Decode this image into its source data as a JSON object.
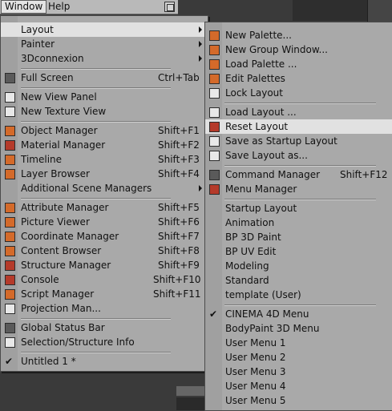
{
  "menubar": {
    "window_label": "Window",
    "help_label": "Help",
    "icon": "window-layout-icon"
  },
  "main_menu": {
    "items": [
      {
        "label": "Layout",
        "shortcut": "",
        "submenu": true,
        "icon": ""
      },
      {
        "label": "Painter",
        "shortcut": "",
        "submenu": true,
        "icon": ""
      },
      {
        "label": "3Dconnexion",
        "shortcut": "",
        "submenu": true,
        "icon": ""
      },
      {
        "label": "Full Screen",
        "shortcut": "Ctrl+Tab",
        "icon": "fullscreen-icon"
      },
      {
        "label": "New View Panel",
        "shortcut": "",
        "icon": "view-panel-icon"
      },
      {
        "label": "New Texture View",
        "shortcut": "",
        "icon": "texture-view-icon"
      },
      {
        "label": "Object Manager",
        "shortcut": "Shift+F1",
        "icon": "object-manager-icon"
      },
      {
        "label": "Material Manager",
        "shortcut": "Shift+F2",
        "icon": "material-manager-icon"
      },
      {
        "label": "Timeline",
        "shortcut": "Shift+F3",
        "icon": "timeline-icon"
      },
      {
        "label": "Layer Browser",
        "shortcut": "Shift+F4",
        "icon": "layer-browser-icon"
      },
      {
        "label": "Additional Scene Managers",
        "shortcut": "",
        "submenu": true,
        "icon": ""
      },
      {
        "label": "Attribute Manager",
        "shortcut": "Shift+F5",
        "icon": "attribute-manager-icon"
      },
      {
        "label": "Picture Viewer",
        "shortcut": "Shift+F6",
        "icon": "picture-viewer-icon"
      },
      {
        "label": "Coordinate Manager",
        "shortcut": "Shift+F7",
        "icon": "coordinate-manager-icon"
      },
      {
        "label": "Content Browser",
        "shortcut": "Shift+F8",
        "icon": "content-browser-icon"
      },
      {
        "label": "Structure Manager",
        "shortcut": "Shift+F9",
        "icon": "structure-manager-icon"
      },
      {
        "label": "Console",
        "shortcut": "Shift+F10",
        "icon": "console-icon"
      },
      {
        "label": "Script Manager",
        "shortcut": "Shift+F11",
        "icon": "script-manager-icon"
      },
      {
        "label": "Projection Man...",
        "shortcut": "",
        "icon": "projection-man-icon"
      },
      {
        "label": "Global Status Bar",
        "shortcut": "",
        "icon": "status-bar-icon"
      },
      {
        "label": "Selection/Structure Info",
        "shortcut": "",
        "icon": "selection-info-icon"
      },
      {
        "label": "Untitled 1 *",
        "shortcut": "",
        "checked": true,
        "icon": "checkmark-icon"
      }
    ]
  },
  "layout_submenu": {
    "items": [
      {
        "label": "New Palette...",
        "shortcut": "",
        "icon": "new-palette-icon"
      },
      {
        "label": "New Group Window...",
        "shortcut": "",
        "icon": "new-group-window-icon"
      },
      {
        "label": "Load Palette ...",
        "shortcut": "",
        "icon": "load-palette-icon"
      },
      {
        "label": "Edit Palettes",
        "shortcut": "",
        "icon": "edit-palettes-icon"
      },
      {
        "label": "Lock Layout",
        "shortcut": "",
        "icon": "lock-layout-icon"
      },
      {
        "label": "Load Layout ...",
        "shortcut": "",
        "icon": "load-layout-icon"
      },
      {
        "label": "Reset Layout",
        "shortcut": "",
        "icon": "reset-layout-icon"
      },
      {
        "label": "Save as Startup Layout",
        "shortcut": "",
        "icon": "save-startup-layout-icon"
      },
      {
        "label": "Save Layout as...",
        "shortcut": "",
        "icon": "save-layout-icon"
      },
      {
        "label": "Command Manager",
        "shortcut": "Shift+F12",
        "icon": "command-manager-icon"
      },
      {
        "label": "Menu Manager",
        "shortcut": "",
        "icon": "menu-manager-icon"
      },
      {
        "label": "Startup Layout",
        "shortcut": ""
      },
      {
        "label": "Animation",
        "shortcut": ""
      },
      {
        "label": "BP 3D Paint",
        "shortcut": ""
      },
      {
        "label": "BP UV Edit",
        "shortcut": ""
      },
      {
        "label": "Modeling",
        "shortcut": ""
      },
      {
        "label": "Standard",
        "shortcut": ""
      },
      {
        "label": "template (User)",
        "shortcut": ""
      },
      {
        "label": "CINEMA 4D Menu",
        "shortcut": "",
        "checked": true
      },
      {
        "label": "BodyPaint 3D Menu",
        "shortcut": ""
      },
      {
        "label": "User Menu 1",
        "shortcut": ""
      },
      {
        "label": "User Menu 2",
        "shortcut": ""
      },
      {
        "label": "User Menu 3",
        "shortcut": ""
      },
      {
        "label": "User Menu 4",
        "shortcut": ""
      },
      {
        "label": "User Menu 5",
        "shortcut": ""
      }
    ]
  },
  "colors": {
    "menu_bg": "#a9a9a9",
    "highlight": "#e1e1e1",
    "icon_orange": "#d46a2a"
  }
}
